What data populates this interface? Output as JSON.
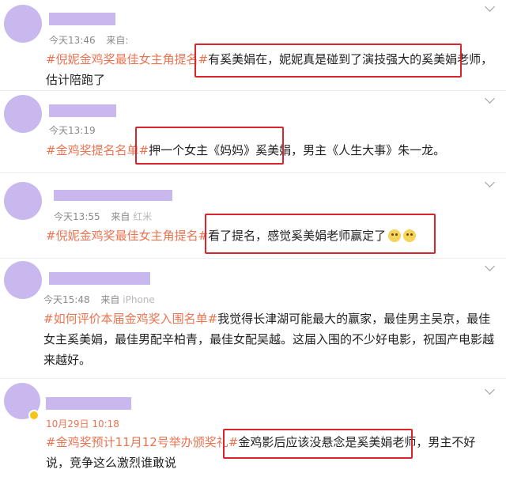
{
  "posts": [
    {
      "time": "今天13:46",
      "source": "来自:",
      "tag": "#倪妮金鸡奖最佳女主角提名#",
      "text": "有奚美娟在，妮妮真是碰到了演技强大的奚美娟老师，估计陪跑了"
    },
    {
      "time": "今天13:19",
      "source": "",
      "tag": "#金鸡奖提名名单#",
      "text": "押一个女主《妈妈》奚美娟，男主《人生大事》朱一龙。"
    },
    {
      "time": "今天13:55",
      "source": "来自",
      "source_extra": "红米",
      "tag": "#倪妮金鸡奖最佳女主角提名#",
      "text": "看了提名，感觉奚美娟老师赢定了",
      "emojis": [
        "doge-emoji",
        "doge-emoji"
      ]
    },
    {
      "time": "今天15:48",
      "source": "来自",
      "source_extra": "iPhone",
      "tag": "#如何评价本届金鸡奖入围名单#",
      "text": "我觉得长津湖可能最大的赢家，最佳男主吴京，最佳女主奚美娟，最佳男配辛柏青，最佳女配吴越。这届入围的不少好电影，祝国产电影越来越好。"
    },
    {
      "time": "10月29日 10:18",
      "source": "",
      "tag": "#金鸡奖预计11月12号举办颁奖礼#",
      "text": "金鸡影后应该没悬念是奚美娟老师，男主不好说，竞争这么激烈谁敢说"
    }
  ],
  "colors": {
    "tag": "#eb7350",
    "highlight_box": "#d9262c",
    "redaction": "#c9b8ee"
  }
}
